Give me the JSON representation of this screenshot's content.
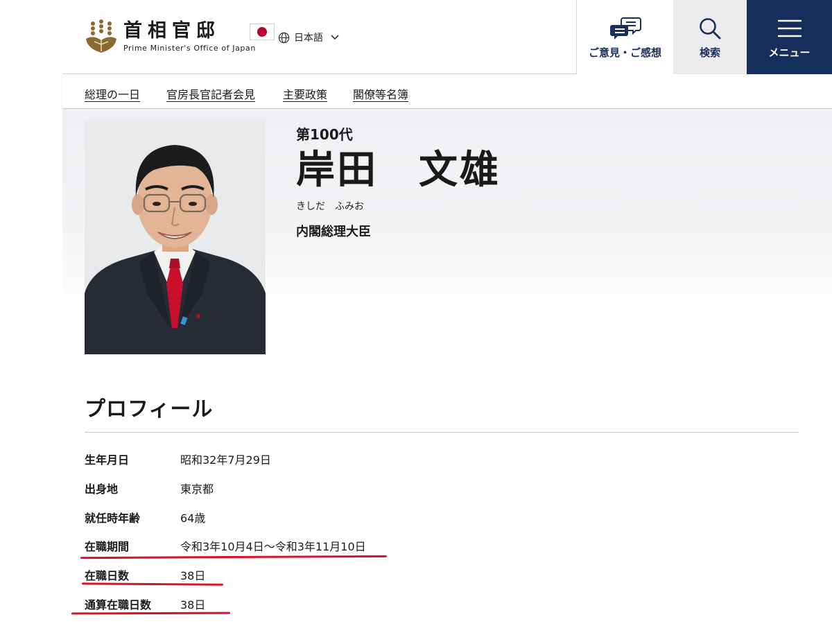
{
  "header": {
    "logo_jp": "首相官邸",
    "logo_en": "Prime Minister's Office of Japan",
    "language": "日本語",
    "opinion_label": "ご意見・ご感想",
    "search_label": "検索",
    "menu_label": "メニュー"
  },
  "nav": {
    "items": [
      "総理の一日",
      "官房長官記者会見",
      "主要政策",
      "閣僚等名簿"
    ]
  },
  "hero": {
    "era": "第100代",
    "name": "岸田　文雄",
    "kana": "きしだ　ふみお",
    "role": "内閣総理大臣"
  },
  "profile": {
    "title": "プロフィール",
    "rows": [
      {
        "label": "生年月日",
        "value": "昭和32年7月29日"
      },
      {
        "label": "出身地",
        "value": "東京都"
      },
      {
        "label": "就任時年齢",
        "value": "64歳"
      },
      {
        "label": "在職期間",
        "value": "令和3年10月4日〜令和3年11月10日"
      },
      {
        "label": "在職日数",
        "value": "38日"
      },
      {
        "label": "通算在職日数",
        "value": "38日"
      }
    ]
  },
  "colors": {
    "navy": "#162e5b",
    "highlight_red": "#d8102a",
    "flag_red": "#bc002d"
  }
}
